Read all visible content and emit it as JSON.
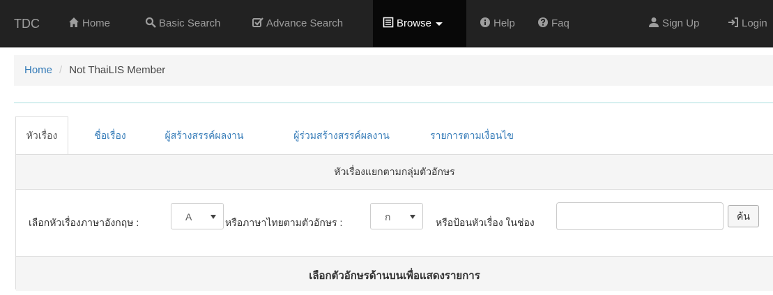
{
  "navbar": {
    "brand": "TDC",
    "items": [
      {
        "label": "Home",
        "icon": "home-icon"
      },
      {
        "label": "Basic Search",
        "icon": "search-icon"
      },
      {
        "label": "Advance Search",
        "icon": "edit-check-icon"
      },
      {
        "label": "Browse",
        "icon": "list-icon",
        "active": true
      },
      {
        "label": "Help",
        "icon": "info-icon"
      },
      {
        "label": "Faq",
        "icon": "question-icon"
      }
    ],
    "right_items": [
      {
        "label": "Sign Up",
        "icon": "user-icon"
      },
      {
        "label": "Login",
        "icon": "login-icon"
      }
    ]
  },
  "breadcrumb": {
    "home": "Home",
    "separator": "/",
    "current": "Not ThaiLIS Member"
  },
  "tabs": [
    {
      "label": "หัวเรื่อง",
      "active": true
    },
    {
      "label": "ชื่อเรื่อง"
    },
    {
      "label": "ผู้สร้างสรรค์ผลงาน"
    },
    {
      "label": "ผู้ร่วมสร้างสรรค์ผลงาน"
    },
    {
      "label": "รายการตามเงื่อนไข"
    }
  ],
  "panel": {
    "heading": "หัวเรื่องแยกตามกลุ่มตัวอักษร",
    "english_label": "เลือกหัวเรื่องภาษาอังกฤษ :",
    "english_selected": "A",
    "thai_label": "หรือภาษาไทยตามตัวอักษร :",
    "thai_selected": "ก",
    "input_label": "หรือป้อนหัวเรื่อง ในช่อง",
    "input_value": "",
    "search_button": "ค้น",
    "footer": "เลือกตัวอักษรด้านบนเพื่อแสดงรายการ"
  },
  "colors": {
    "navbar_bg": "#222222",
    "navbar_active_bg": "#080808",
    "nav_text": "#9d9d9d",
    "link": "#337ab7",
    "panel_bg": "#f5f5f5"
  }
}
